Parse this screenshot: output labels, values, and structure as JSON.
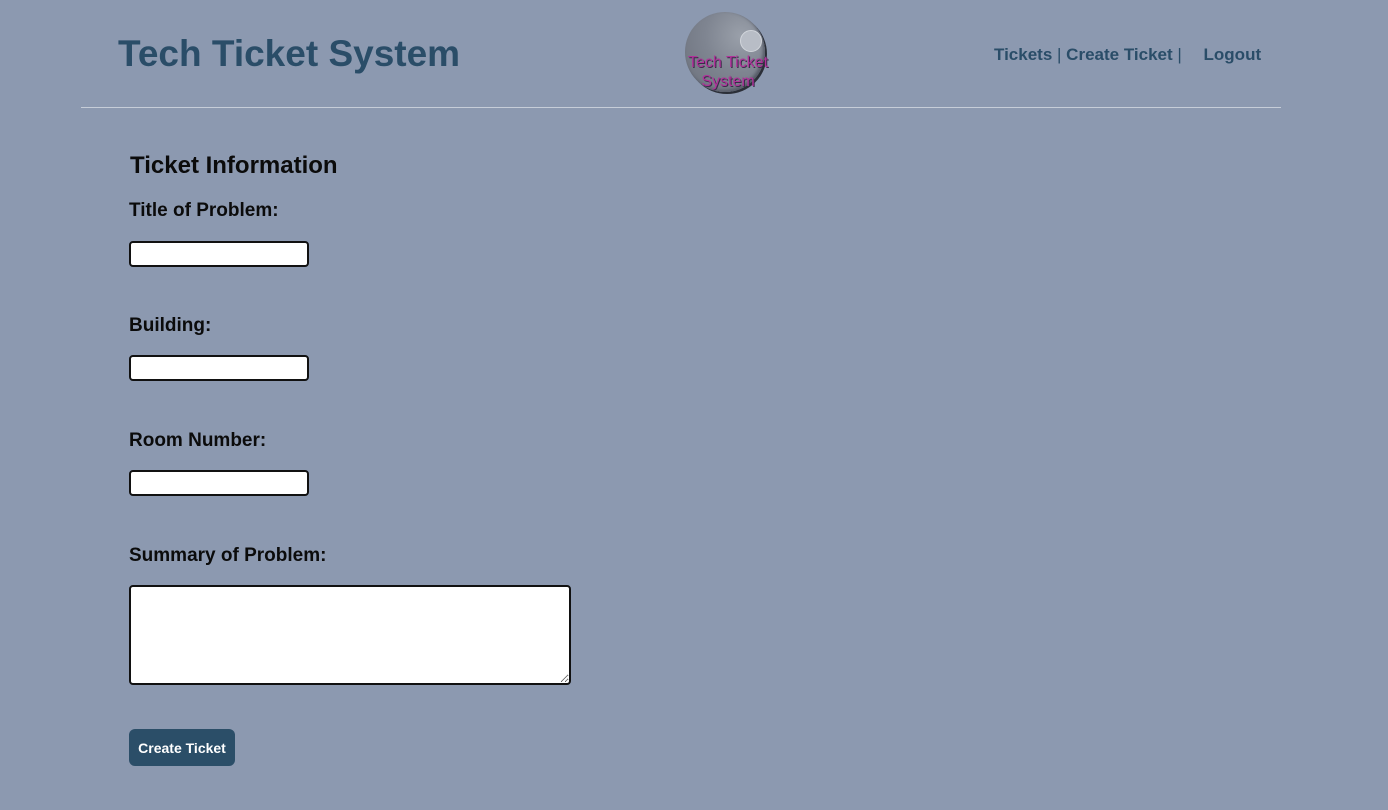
{
  "header": {
    "title": "Tech Ticket System",
    "logo_text": "Tech Ticket\nSystem",
    "nav": {
      "tickets": "Tickets",
      "separator1": "|",
      "create_ticket": "Create Ticket",
      "separator2": "|",
      "logout": "Logout"
    }
  },
  "form": {
    "heading": "Ticket Information",
    "fields": [
      {
        "label": "Title of Problem:",
        "value": "",
        "placeholder": ""
      },
      {
        "label": "Building:",
        "value": "",
        "placeholder": ""
      },
      {
        "label": "Room Number:",
        "value": "",
        "placeholder": ""
      },
      {
        "label": "Summary of Problem:",
        "value": "",
        "placeholder": ""
      }
    ],
    "submit_label": "Create Ticket"
  },
  "colors": {
    "background": "#8c99b0",
    "accent": "#2a4d68",
    "button": "#2b4e68",
    "logo_text": "#b0329a"
  },
  "icons": {
    "logo": "sphere-logo-icon",
    "resize": "resize-grip-icon"
  }
}
